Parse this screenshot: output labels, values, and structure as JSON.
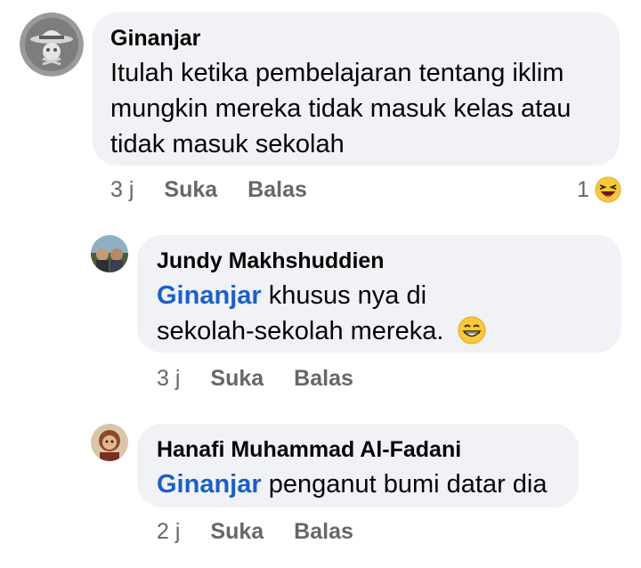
{
  "comments": [
    {
      "author": "Ginanjar",
      "text": "Itulah ketika pembelajaran tentang iklim mungkin mereka tidak masuk kelas atau tidak masuk sekolah",
      "time": "3 j",
      "like_label": "Suka",
      "reply_label": "Balas",
      "reaction_count": "1",
      "reaction_icon": "laughing-emoji-icon"
    },
    {
      "author": "Jundy Makhshuddien",
      "mention": "Ginanjar",
      "text_line1": " khusus nya di",
      "text_line2": "sekolah-sekolah mereka. ",
      "inline_emoji": "grinning-emoji-icon",
      "time": "3 j",
      "like_label": "Suka",
      "reply_label": "Balas"
    },
    {
      "author": "Hanafi Muhammad Al-Fadani",
      "mention": "Ginanjar",
      "text": " penganut bumi datar dia",
      "time": "2 j",
      "like_label": "Suka",
      "reply_label": "Balas"
    }
  ],
  "colors": {
    "bubble": "#f0f2f5",
    "mention": "#1b5fc8",
    "meta": "#65676b",
    "text": "#050505"
  }
}
